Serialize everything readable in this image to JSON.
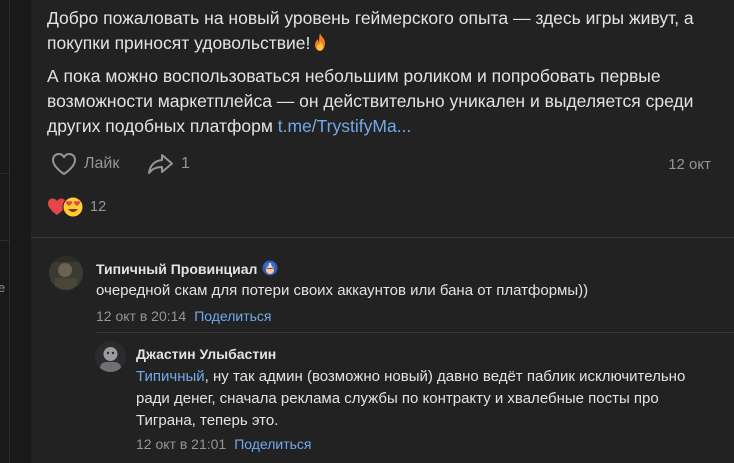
{
  "post": {
    "paragraph1": "Добро пожаловать на новый уровень геймерского опыта — здесь игры живут, а покупки приносят удовольствие!",
    "paragraph2": "А пока можно воспользоваться небольшим роликом и попробовать первые возможности маркетплейса — он действительно уникален и выделяется среди других подобных платформ ",
    "link": "t.me/TrystifyMa...",
    "like_label": "Лайк",
    "share_count": "1",
    "date": "12 окт",
    "reactions_count": "12"
  },
  "comments": [
    {
      "author": "Типичный Провинциал",
      "text": "очередной скам для потери своих аккаунтов или бана от платформы))",
      "time": "12 окт в 20:14",
      "share_label": "Поделиться"
    },
    {
      "author": "Джастин Улыбастин",
      "mention": "Типичный",
      "text": ", ну так админ (возможно новый) давно ведёт паблик исключительно ради денег, сначала реклама службы по контракту и хвалебные посты про Тиграна, теперь это.",
      "time": "12 окт в 21:01",
      "share_label": "Поделиться"
    }
  ],
  "sidebar": {
    "fragment": "e"
  },
  "colors": {
    "accent": "#71aaeb",
    "background": "#222222",
    "secondary_text": "#939699",
    "heart": "#e64646"
  }
}
